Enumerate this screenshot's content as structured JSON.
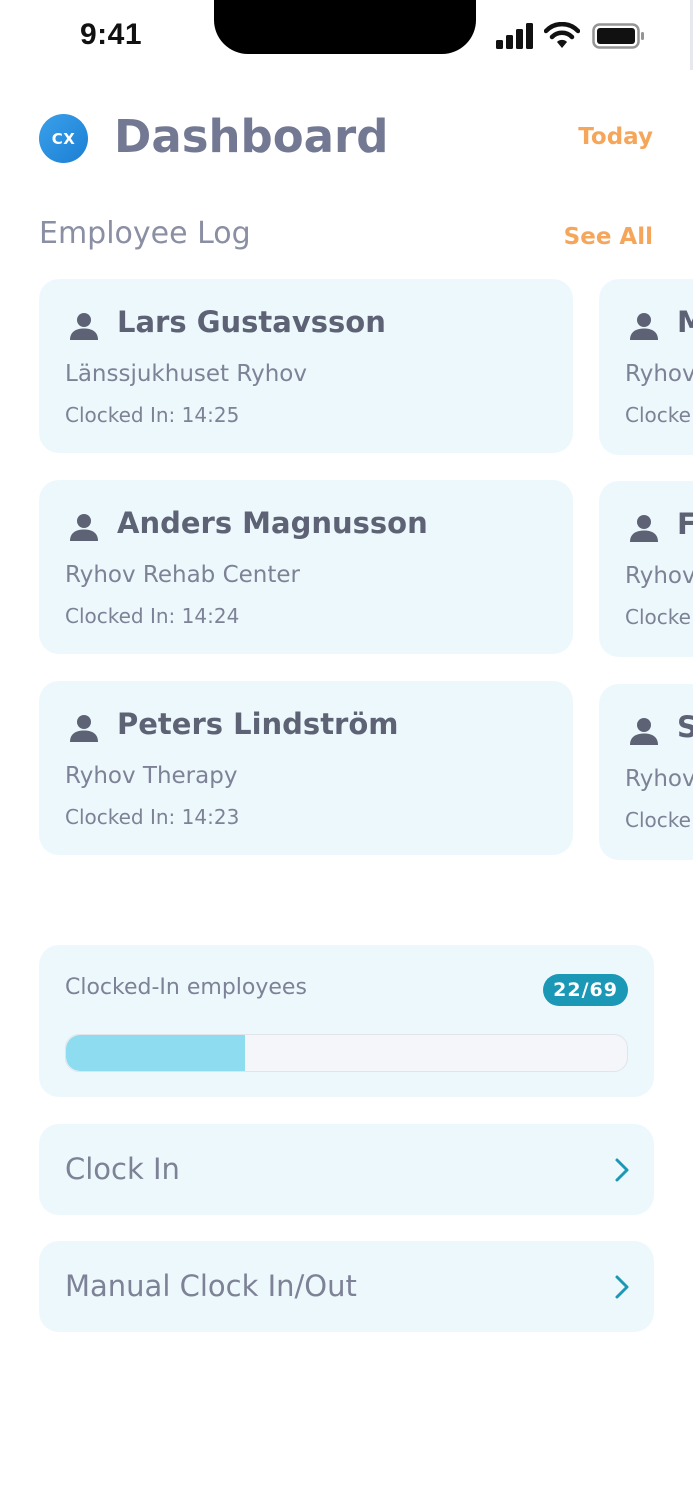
{
  "status_bar": {
    "time": "9:41"
  },
  "header": {
    "avatar_initials": "CX",
    "title": "Dashboard",
    "period_label": "Today"
  },
  "employee_log": {
    "title": "Employee Log",
    "see_all": "See All",
    "cards": [
      {
        "name": "Lars Gustavsson",
        "location": "Länssjukhuset Ryhov",
        "clock": "Clocked In: 14:25"
      },
      {
        "name": "Anders Magnusson",
        "location": "Ryhov Rehab Center",
        "clock": "Clocked In: 14:24"
      },
      {
        "name": "Peters Lindström",
        "location": "Ryhov Therapy",
        "clock": "Clocked In: 14:23"
      }
    ],
    "partial_cards": [
      {
        "name": "M",
        "location": "Ryhov",
        "clock": "Clocke"
      },
      {
        "name": "F",
        "location": "Ryhov",
        "clock": "Clocke"
      },
      {
        "name": "S",
        "location": "Ryhov",
        "clock": "Clocke"
      }
    ]
  },
  "clocked_in": {
    "label": "Clocked-In employees",
    "badge": "22/69",
    "count": 22,
    "total": 69,
    "fill_color": "#8ddcef"
  },
  "actions": [
    {
      "label": "Clock In",
      "icon": "chevron-right-icon"
    },
    {
      "label": "Manual Clock In/Out",
      "icon": "chevron-right-icon"
    }
  ],
  "colors": {
    "accent_orange": "#f5a65a",
    "badge_teal": "#1b98b5",
    "card_background": "#edf8fd",
    "avatar_blue": "#2a8fe0"
  }
}
